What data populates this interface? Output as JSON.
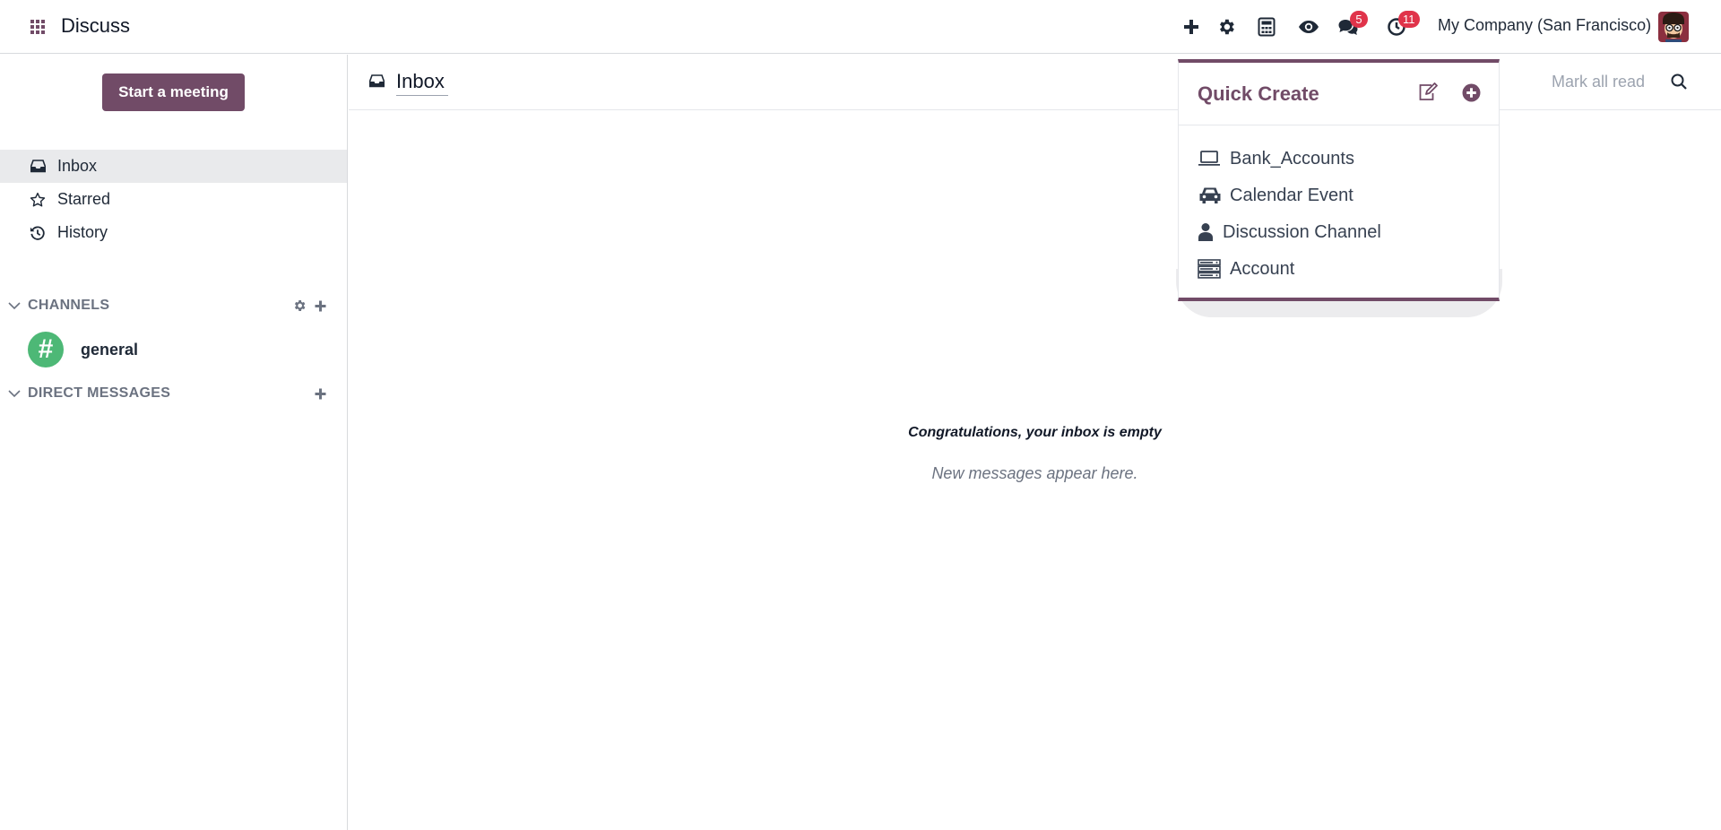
{
  "navbar": {
    "app_title": "Discuss",
    "company": "My Company (San Francisco)",
    "messages_badge": "5",
    "activities_badge": "11"
  },
  "sidebar": {
    "start_meeting": "Start a meeting",
    "items": [
      {
        "label": "Inbox",
        "icon": "inbox-icon",
        "active": true
      },
      {
        "label": "Starred",
        "icon": "star-icon"
      },
      {
        "label": "History",
        "icon": "history-icon"
      }
    ],
    "channels_label": "CHANNELS",
    "channels": [
      {
        "name": "general",
        "glyph": "#"
      }
    ],
    "direct_messages_label": "DIRECT MESSAGES"
  },
  "main": {
    "title": "Inbox",
    "mark_all_read": "Mark all read",
    "empty_title": "Congratulations, your inbox is empty",
    "empty_subtitle": "New messages appear here."
  },
  "quick_create": {
    "title": "Quick Create",
    "items": [
      {
        "label": "Bank_Accounts",
        "icon": "laptop-icon"
      },
      {
        "label": "Calendar Event",
        "icon": "car-icon"
      },
      {
        "label": "Discussion Channel",
        "icon": "user-icon"
      },
      {
        "label": "Account",
        "icon": "server-icon"
      }
    ]
  },
  "colors": {
    "brand": "#714b67",
    "badge": "#e0334a",
    "channel_avatar": "#4db876",
    "active_bg": "#e9eaec"
  }
}
